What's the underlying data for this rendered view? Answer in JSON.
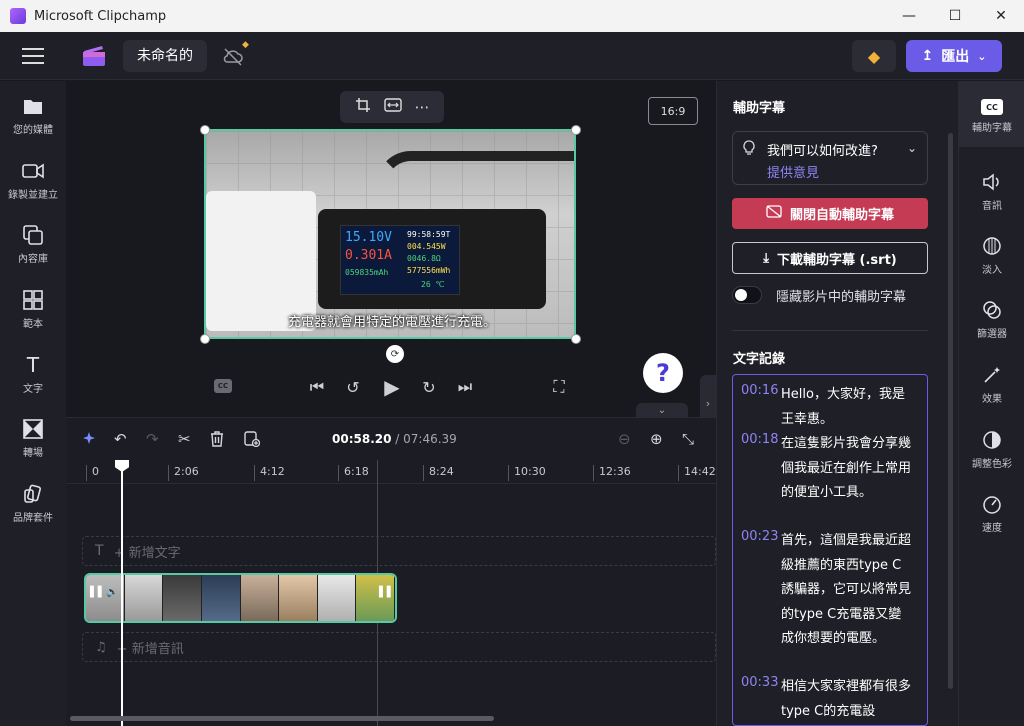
{
  "window": {
    "title": "Microsoft Clipchamp",
    "minimize": "—",
    "maximize": "☐",
    "close": "✕"
  },
  "topbar": {
    "project_name": "未命名的",
    "export_label": "匯出",
    "export_icon": "↥",
    "export_chevron": "⌄",
    "gem_icon": "◆"
  },
  "left_sidebar": {
    "items": [
      {
        "icon": "folder-icon",
        "glyph": "▮",
        "label": "您的媒體"
      },
      {
        "icon": "record-icon",
        "glyph": "◫",
        "label": "錄製並建立"
      },
      {
        "icon": "content-library-icon",
        "glyph": "⧉",
        "label": "內容庫"
      },
      {
        "icon": "templates-icon",
        "glyph": "⊞",
        "label": "範本"
      },
      {
        "icon": "text-icon",
        "glyph": "T",
        "label": "文字"
      },
      {
        "icon": "transitions-icon",
        "glyph": "⧖",
        "label": "轉場"
      },
      {
        "icon": "brand-kit-icon",
        "glyph": "▱",
        "label": "品牌套件"
      }
    ]
  },
  "preview": {
    "aspect_ratio": "16:9",
    "subtitle": "充電器就會用特定的電壓進行充電。",
    "meter": {
      "voltage": "15.10V",
      "current": "0.301A",
      "mah": "059835mAh",
      "time": "99:58:59T",
      "watt": "004.545W",
      "ohm": "0046.8Ω",
      "wh": "577556mWh",
      "temp": "26 ℃"
    }
  },
  "playback": {
    "cc": "CC",
    "skip_back": "⏮",
    "rewind": "↺",
    "play": "▶",
    "forward": "↻",
    "skip_forward": "⏭",
    "fullscreen": "⛶"
  },
  "help_glyph": "?",
  "timeline": {
    "current_time": "00:58.20",
    "total_time": " / 07:46.39",
    "ticks": [
      "0",
      "2:06",
      "4:12",
      "6:18",
      "8:24",
      "10:30",
      "12:36",
      "14:42"
    ],
    "add_text": "新增文字",
    "add_audio": "新增音訊"
  },
  "captions_panel": {
    "title": "輔助字幕",
    "feedback_question": "我們可以如何改進?",
    "feedback_link": "提供意見",
    "close_auto_label": "關閉自動輔助字幕",
    "download_label": "下載輔助字幕 (.srt)",
    "hide_label": "隱藏影片中的輔助字幕",
    "transcript_title": "文字記錄",
    "transcript": [
      {
        "time": "00:16",
        "text": "Hello，大家好，我是王幸惠。"
      },
      {
        "time": "00:18",
        "text": "在這隻影片我會分享幾個我最近在創作上常用的便宜小工具。"
      },
      {
        "time": "00:23",
        "text": "首先，這個是我最近超級推薦的東西type C誘騙器，它可以將常見的type C充電器又變成你想要的電壓。"
      },
      {
        "time": "00:33",
        "text": "相信大家家裡都有很多type C的充電設"
      }
    ]
  },
  "right_tools": {
    "items": [
      {
        "icon": "captions-icon",
        "label": "輔助字幕"
      },
      {
        "icon": "audio-icon",
        "glyph": "🔈",
        "label": "音訊"
      },
      {
        "icon": "fade-icon",
        "glyph": "◑",
        "label": "淡入"
      },
      {
        "icon": "filters-icon",
        "glyph": "◍",
        "label": "篩選器"
      },
      {
        "icon": "effects-icon",
        "glyph": "✧",
        "label": "效果"
      },
      {
        "icon": "adjust-colors-icon",
        "glyph": "◐",
        "label": "調整色彩"
      },
      {
        "icon": "speed-icon",
        "glyph": "◔",
        "label": "速度"
      }
    ]
  },
  "colors": {
    "accent": "#6b5ce7",
    "selection": "#57c9a5",
    "danger": "#c53b54",
    "gem": "#f2b23a"
  }
}
